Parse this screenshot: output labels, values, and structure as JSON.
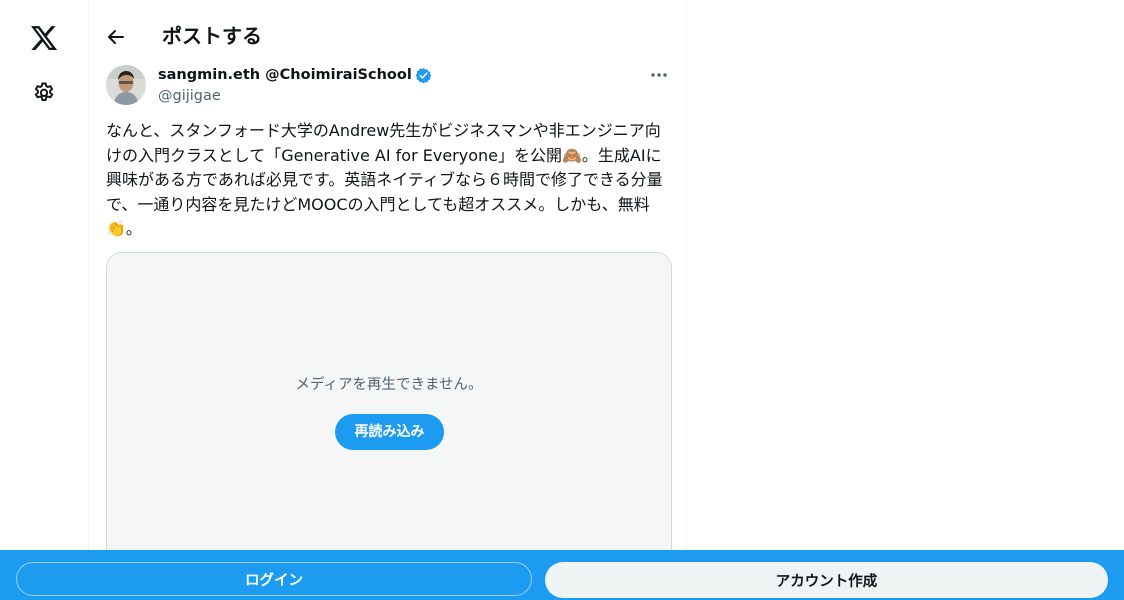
{
  "nav": {
    "logo_icon": "x-logo-icon",
    "settings_icon": "gear-icon"
  },
  "header": {
    "back_icon": "arrow-left-icon",
    "title": "ポストする"
  },
  "post": {
    "display_name": "sangmin.eth @ChoimiraiSchool",
    "handle": "@gijigae",
    "verified_icon": "verified-badge-icon",
    "more_icon": "more-horizontal-icon",
    "text": "なんと、スタンフォード大学のAndrew先生がビジネスマンや非エンジニア向けの入門クラスとして「Generative AI for Everyone」を公開🙈。生成AIに興味がある方であれば必見です。英語ネイティブなら６時間で修了できる分量で、一通り内容を見たけどMOOCの入門としても超オススメ。しかも、無料👏。",
    "media": {
      "error_message": "メディアを再生できません。",
      "reload_label": "再読み込み"
    }
  },
  "bottom_bar": {
    "login_label": "ログイン",
    "signup_label": "アカウント作成"
  },
  "colors": {
    "accent": "#1d9bf0",
    "text": "#0f1419",
    "secondary_text": "#536471",
    "border": "#eff3f4"
  }
}
